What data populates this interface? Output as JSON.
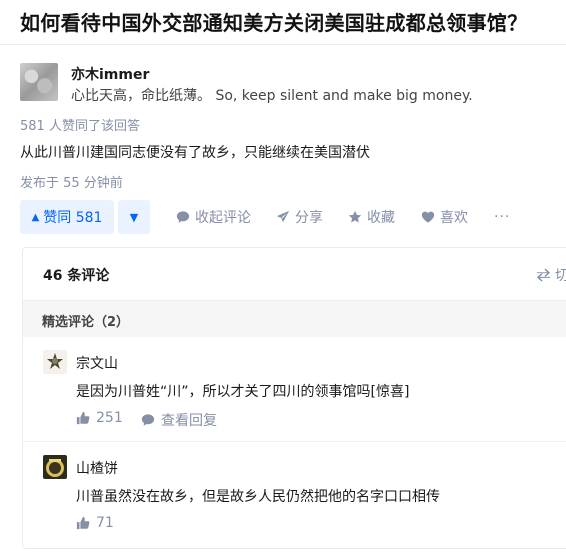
{
  "question": {
    "title": "如何看待中国外交部通知美方关闭美国驻成都总领事馆？"
  },
  "author": {
    "name": "亦木immer",
    "bio": "心比天高，命比纸薄。 So, keep silent and make big money."
  },
  "answer": {
    "vote_summary": "581 人赞同了该回答",
    "text": "从此川普川建国同志便没有了故乡，只能继续在美国潜伏",
    "publish_time": "发布于 55 分钟前"
  },
  "actions": {
    "upvote_label": "赞同 581",
    "upvote_icon": "▲",
    "downvote_icon": "▼",
    "collapse_comments": "收起评论",
    "share": "分享",
    "favorite": "收藏",
    "like": "喜欢",
    "more": "···"
  },
  "comments": {
    "count_label": "46 条评论",
    "switch_label": "切",
    "featured_label": "精选评论（2）",
    "items": [
      {
        "name": "宗文山",
        "text": "是因为川普姓“川”，所以才关了四川的领事馆吗[惊喜]",
        "likes": "251",
        "reply_label": "查看回复"
      },
      {
        "name": "山楂饼",
        "text": "川普虽然没在故乡，但是故乡人民仍然把他的名字口口相传",
        "likes": "71"
      }
    ]
  },
  "colors": {
    "accent": "#0066ff",
    "accent_bg": "#eaf2ff",
    "meta_gray": "#8590a6"
  }
}
